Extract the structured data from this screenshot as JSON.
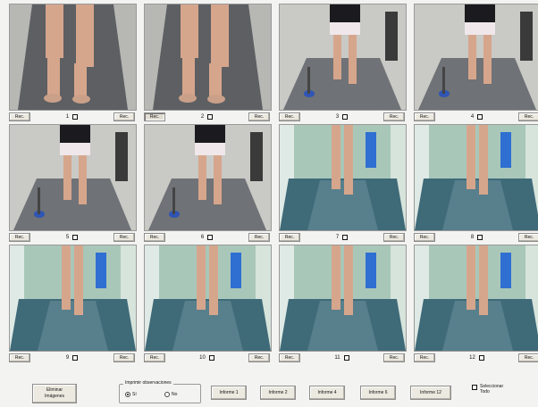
{
  "cells": [
    {
      "num": "1",
      "left": "Rec.",
      "right": "Rec.",
      "scene": "close",
      "left_pressed": false
    },
    {
      "num": "2",
      "left": "Rec.",
      "right": "Rec.",
      "scene": "close",
      "left_pressed": true
    },
    {
      "num": "3",
      "left": "Rec.",
      "right": "Rec.",
      "scene": "mid",
      "left_pressed": false
    },
    {
      "num": "4",
      "left": "Rec.",
      "right": "Rec.",
      "scene": "mid",
      "left_pressed": false
    },
    {
      "num": "5",
      "left": "Rec.",
      "right": "Rec.",
      "scene": "mid",
      "left_pressed": false
    },
    {
      "num": "6",
      "left": "Rec.",
      "right": "Rec.",
      "scene": "mid",
      "left_pressed": false
    },
    {
      "num": "7",
      "left": "Rec.",
      "right": "Rec.",
      "scene": "hall",
      "left_pressed": false
    },
    {
      "num": "8",
      "left": "Rec.",
      "right": "Rec.",
      "scene": "hall",
      "left_pressed": false
    },
    {
      "num": "9",
      "left": "Rec.",
      "right": "Rec.",
      "scene": "hall",
      "left_pressed": false
    },
    {
      "num": "10",
      "left": "Rec.",
      "right": "Rec.",
      "scene": "hall",
      "left_pressed": false
    },
    {
      "num": "11",
      "left": "Rec.",
      "right": "Rec.",
      "scene": "hall",
      "left_pressed": false
    },
    {
      "num": "12",
      "left": "Rec.",
      "right": "Rec.",
      "scene": "hall",
      "left_pressed": false
    }
  ],
  "bottom": {
    "eliminar_line1": "Eliminar",
    "eliminar_line2": "Imágenes",
    "group_title": "Imprimir observaciones",
    "radio_si": "Sí",
    "radio_no": "No",
    "radio_selected": "si",
    "informes": [
      {
        "label": "Informe 1"
      },
      {
        "label": "Informe 2"
      },
      {
        "label": "Informe 4"
      },
      {
        "label": "Informe 6"
      },
      {
        "label": "Informe 12"
      }
    ],
    "select_all_line1": "Seleccionar",
    "select_all_line2": "Todo"
  },
  "colors": {
    "floor_close": "#5d5f63",
    "floor_hall": "#3f6a78",
    "wall_hall": "#a9c7b9",
    "skin": "#d6a68c",
    "shirt": "#1b1b1f",
    "shorts": "#efe7e9"
  }
}
